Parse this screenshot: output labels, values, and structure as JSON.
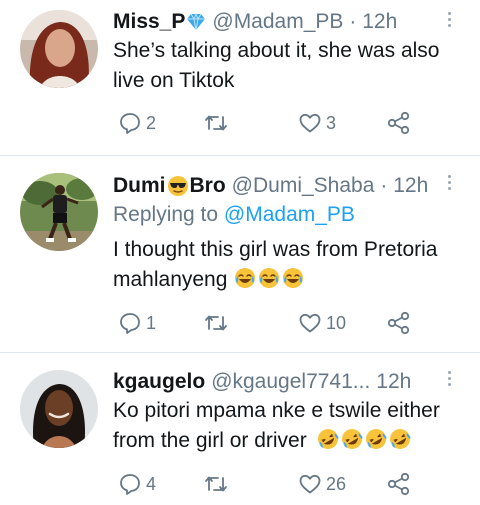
{
  "tweets": [
    {
      "name": "Miss_P",
      "handle": "@Madam_PB",
      "time": "· 12h",
      "reply_prefix": "",
      "reply_to": "",
      "text_lines": [
        "She’s talking about it, she was also",
        "live on Tiktok"
      ],
      "reply_count": "2",
      "retweet_count": "",
      "like_count": "3"
    },
    {
      "name": "Dumi",
      "name_suffix": "Bro",
      "handle": "@Dumi_Shaba",
      "time": "· 12h",
      "reply_prefix": "Replying to",
      "reply_to": "@Madam_PB",
      "text_lines": [
        "I thought this girl was from Pretoria",
        "mahlanyeng"
      ],
      "reply_count": "1",
      "retweet_count": "",
      "like_count": "10"
    },
    {
      "name": "kgaugelo",
      "handle": "@kgaugel7741...",
      "time": "12h",
      "reply_prefix": "",
      "reply_to": "",
      "text_lines": [
        "Ko pitori mpama nke e tswile either",
        "from the girl or driver"
      ],
      "reply_count": "4",
      "retweet_count": "",
      "like_count": "26"
    }
  ],
  "icons": {
    "verified": "blue-diamond-icon",
    "sunglasses": "sunglasses-emoji-icon",
    "laugh": "face-with-tears-of-joy-icon",
    "rofl": "rolling-on-floor-laughing-icon",
    "reply": "reply-bubble-icon",
    "retweet": "retweet-icon",
    "like": "heart-icon",
    "share": "share-icon",
    "more": "more-vertical-icon"
  },
  "colors": {
    "text": "#14171a",
    "secondary": "#657786",
    "link": "#1da1f2",
    "divider": "#e1e8ed"
  }
}
